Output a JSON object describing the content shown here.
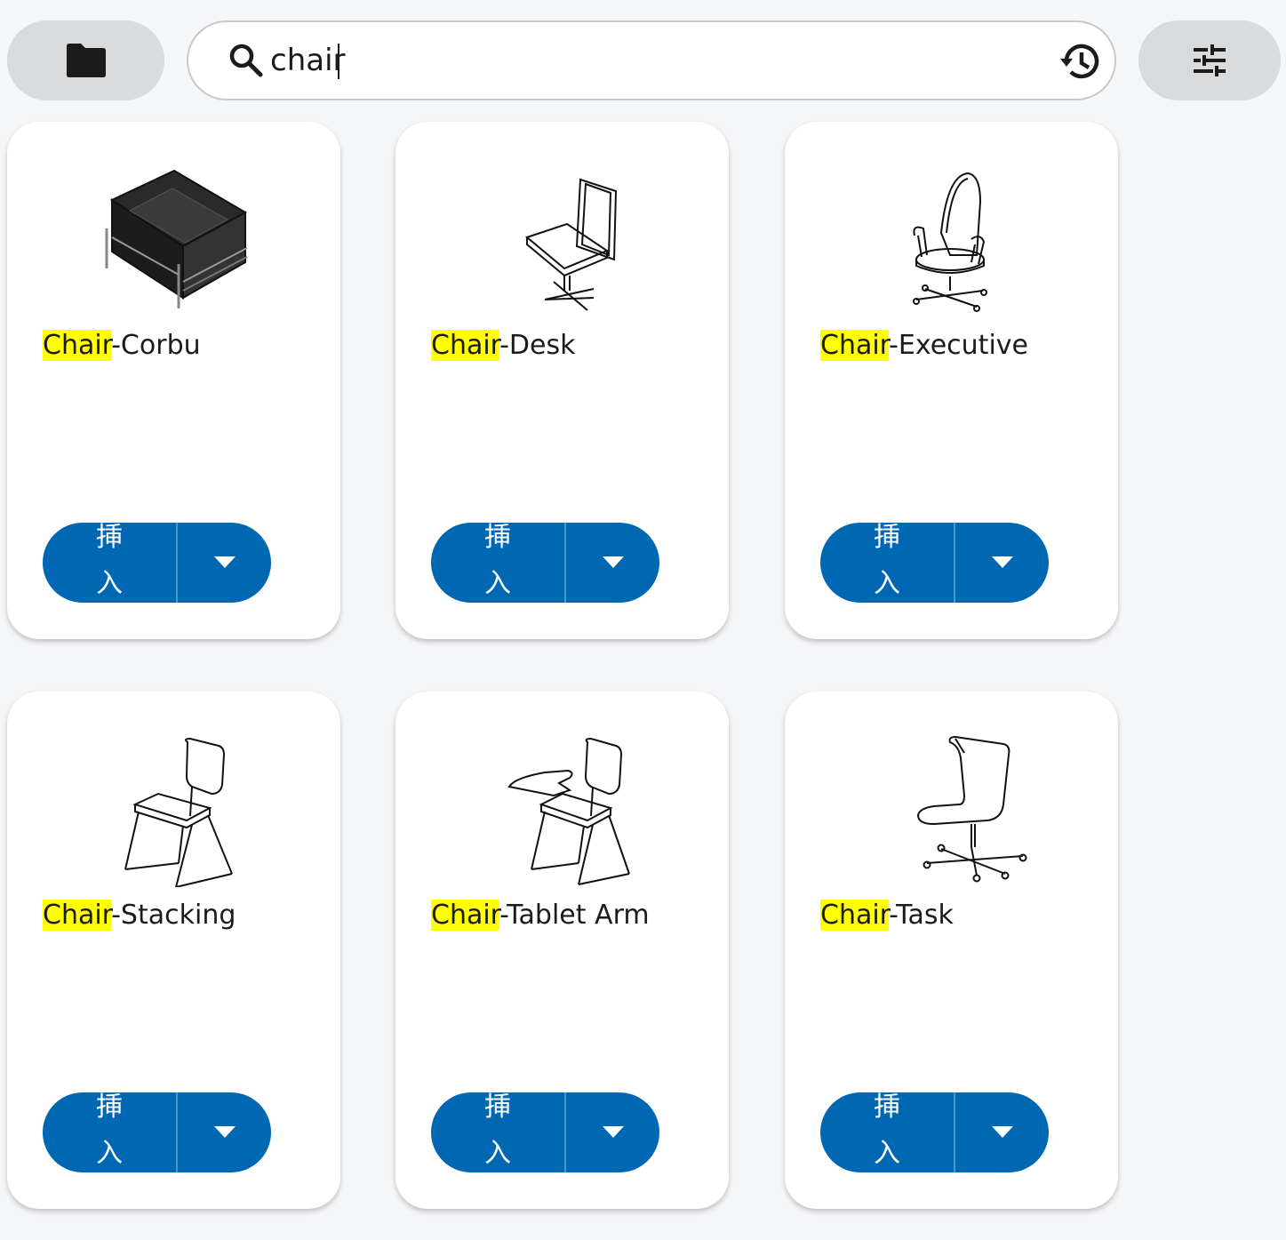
{
  "toolbar": {
    "folder_icon": "folder-icon",
    "search": {
      "value": "chair",
      "placeholder": "",
      "icon": "search-icon",
      "history_icon": "history-icon"
    },
    "filter_icon": "tune-sliders-icon"
  },
  "colors": {
    "accent": "#0067b3",
    "highlight": "#ffff00",
    "background": "#f5f6f8",
    "pill": "#d9dadc"
  },
  "items": [
    {
      "highlight": "Chair",
      "rest": "-Corbu",
      "insert_label": "挿入",
      "thumbnail": "lounge-armchair"
    },
    {
      "highlight": "Chair",
      "rest": "-Desk",
      "insert_label": "挿入",
      "thumbnail": "desk-chair"
    },
    {
      "highlight": "Chair",
      "rest": "-Executive",
      "insert_label": "挿入",
      "thumbnail": "executive-chair"
    },
    {
      "highlight": "Chair",
      "rest": "-Stacking",
      "insert_label": "挿入",
      "thumbnail": "stacking-chair"
    },
    {
      "highlight": "Chair",
      "rest": "-Tablet Arm",
      "insert_label": "挿入",
      "thumbnail": "tablet-arm-chair"
    },
    {
      "highlight": "Chair",
      "rest": "-Task",
      "insert_label": "挿入",
      "thumbnail": "task-chair"
    }
  ]
}
